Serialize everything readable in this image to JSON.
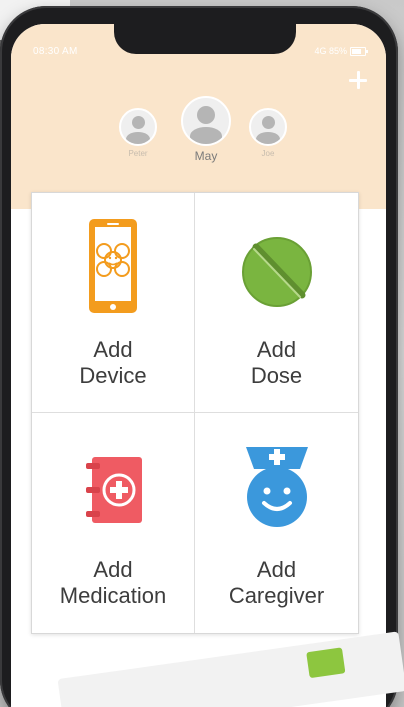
{
  "status_bar": {
    "time": "08:30 AM",
    "right": "4G 85%"
  },
  "profiles": [
    {
      "name": "Peter",
      "selected": false
    },
    {
      "name": "May",
      "selected": true
    },
    {
      "name": "Joe",
      "selected": false
    }
  ],
  "tiles": [
    {
      "line1": "Add",
      "line2": "Device",
      "icon": "phone-device-icon",
      "color": "#f39c1e"
    },
    {
      "line1": "Add",
      "line2": "Dose",
      "icon": "pill-icon",
      "color": "#7ab540"
    },
    {
      "line1": "Add",
      "line2": "Medication",
      "icon": "medical-book-icon",
      "color": "#ef5b63"
    },
    {
      "line1": "Add",
      "line2": "Caregiver",
      "icon": "nurse-icon",
      "color": "#3b98dc"
    }
  ],
  "colors": {
    "header_bg": "#fae5cb",
    "phone_frame": "#1d1d1f",
    "label_text": "#3d3d3d"
  }
}
